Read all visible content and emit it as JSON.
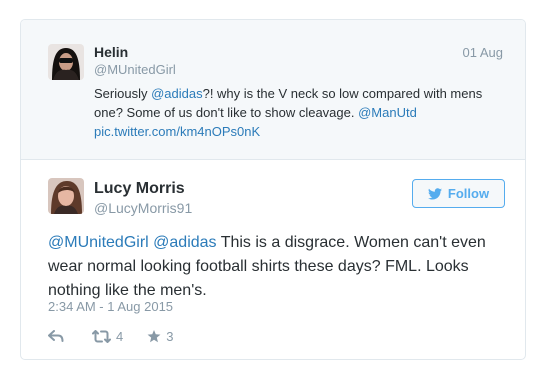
{
  "quoted_tweet": {
    "name": "Helin",
    "handle": "@MUnitedGirl",
    "date": "01 Aug",
    "text_prefix": "Seriously ",
    "mention_1": "@adidas",
    "text_body": "?! why is the V neck so low compared with mens one? Some of us don't like to show cleavage. ",
    "mention_2": "@ManUtd",
    "pic_link": "pic.twitter.com/km4nOPs0nK"
  },
  "main_tweet": {
    "name": "Lucy Morris",
    "handle": "@LucyMorris91",
    "follow_label": "Follow",
    "mention_1": "@MUnitedGirl",
    "mention_2": "@adidas",
    "text_body": " This is a disgrace. Women can't even wear normal looking football shirts these days? FML. Looks nothing like the men's.",
    "timestamp": "2:34 AM - 1 Aug 2015",
    "retweet_count": "4",
    "favorite_count": "3"
  },
  "icons": {
    "reply": "reply-icon",
    "retweet": "retweet-icon",
    "favorite": "star-icon",
    "follow": "twitter-bird-icon"
  },
  "colors": {
    "link": "#2b7bb9",
    "follow_blue": "#55acee",
    "muted": "#8899a6"
  }
}
